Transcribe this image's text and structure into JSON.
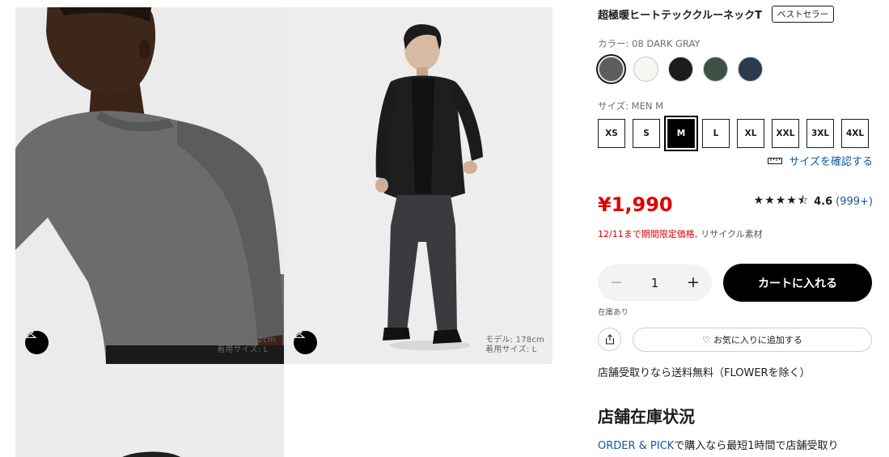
{
  "product": {
    "title": "超極暖ヒートテッククルーネックT",
    "badge": "ベストセラー",
    "color_label": "カラー: 08 DARK GRAY",
    "colors": [
      {
        "name": "dark-gray",
        "hex": "#5d5d5f",
        "selected": true
      },
      {
        "name": "off-white",
        "hex": "#f7f6f0",
        "selected": false
      },
      {
        "name": "black",
        "hex": "#1c1c1c",
        "selected": false
      },
      {
        "name": "green",
        "hex": "#3b5245",
        "selected": false
      },
      {
        "name": "navy",
        "hex": "#2c3a4e",
        "selected": false
      }
    ],
    "size_label": "サイズ: MEN M",
    "sizes": [
      "XS",
      "S",
      "M",
      "L",
      "XL",
      "XXL",
      "3XL",
      "4XL"
    ],
    "selected_size": "M",
    "size_guide_label": "サイズを確認する",
    "price": "¥1,990",
    "rating": {
      "stars": "★★★★⯪",
      "score": "4.6",
      "count": "(999+)"
    },
    "promo": {
      "limited": "12/11まで期間限定価格,",
      "material": "リサイクル素材"
    },
    "quantity": {
      "minus": "−",
      "value": "1",
      "plus": "+"
    },
    "cart_button": "カートに入れる",
    "stock_status": "在庫あり",
    "favorite_button": "お気に入りに追加する",
    "shipping_note": "店舗受取りなら送料無料（FLOWERを除く）",
    "store_stock_heading": "店舗在庫状況",
    "pickup": {
      "link": "ORDER & PICK",
      "text": "で購入なら最短1時間で店舗受取り"
    }
  },
  "gallery": {
    "photos": [
      {
        "caption_line1": "モデル: 182cm",
        "caption_line2": "着用サイズ: L"
      },
      {
        "caption_line1": "モデル: 178cm",
        "caption_line2": "着用サイズ: L"
      }
    ]
  },
  "colors": {
    "price_red": "#e00000",
    "link_blue": "#1457a6",
    "primary_black": "#000000"
  }
}
